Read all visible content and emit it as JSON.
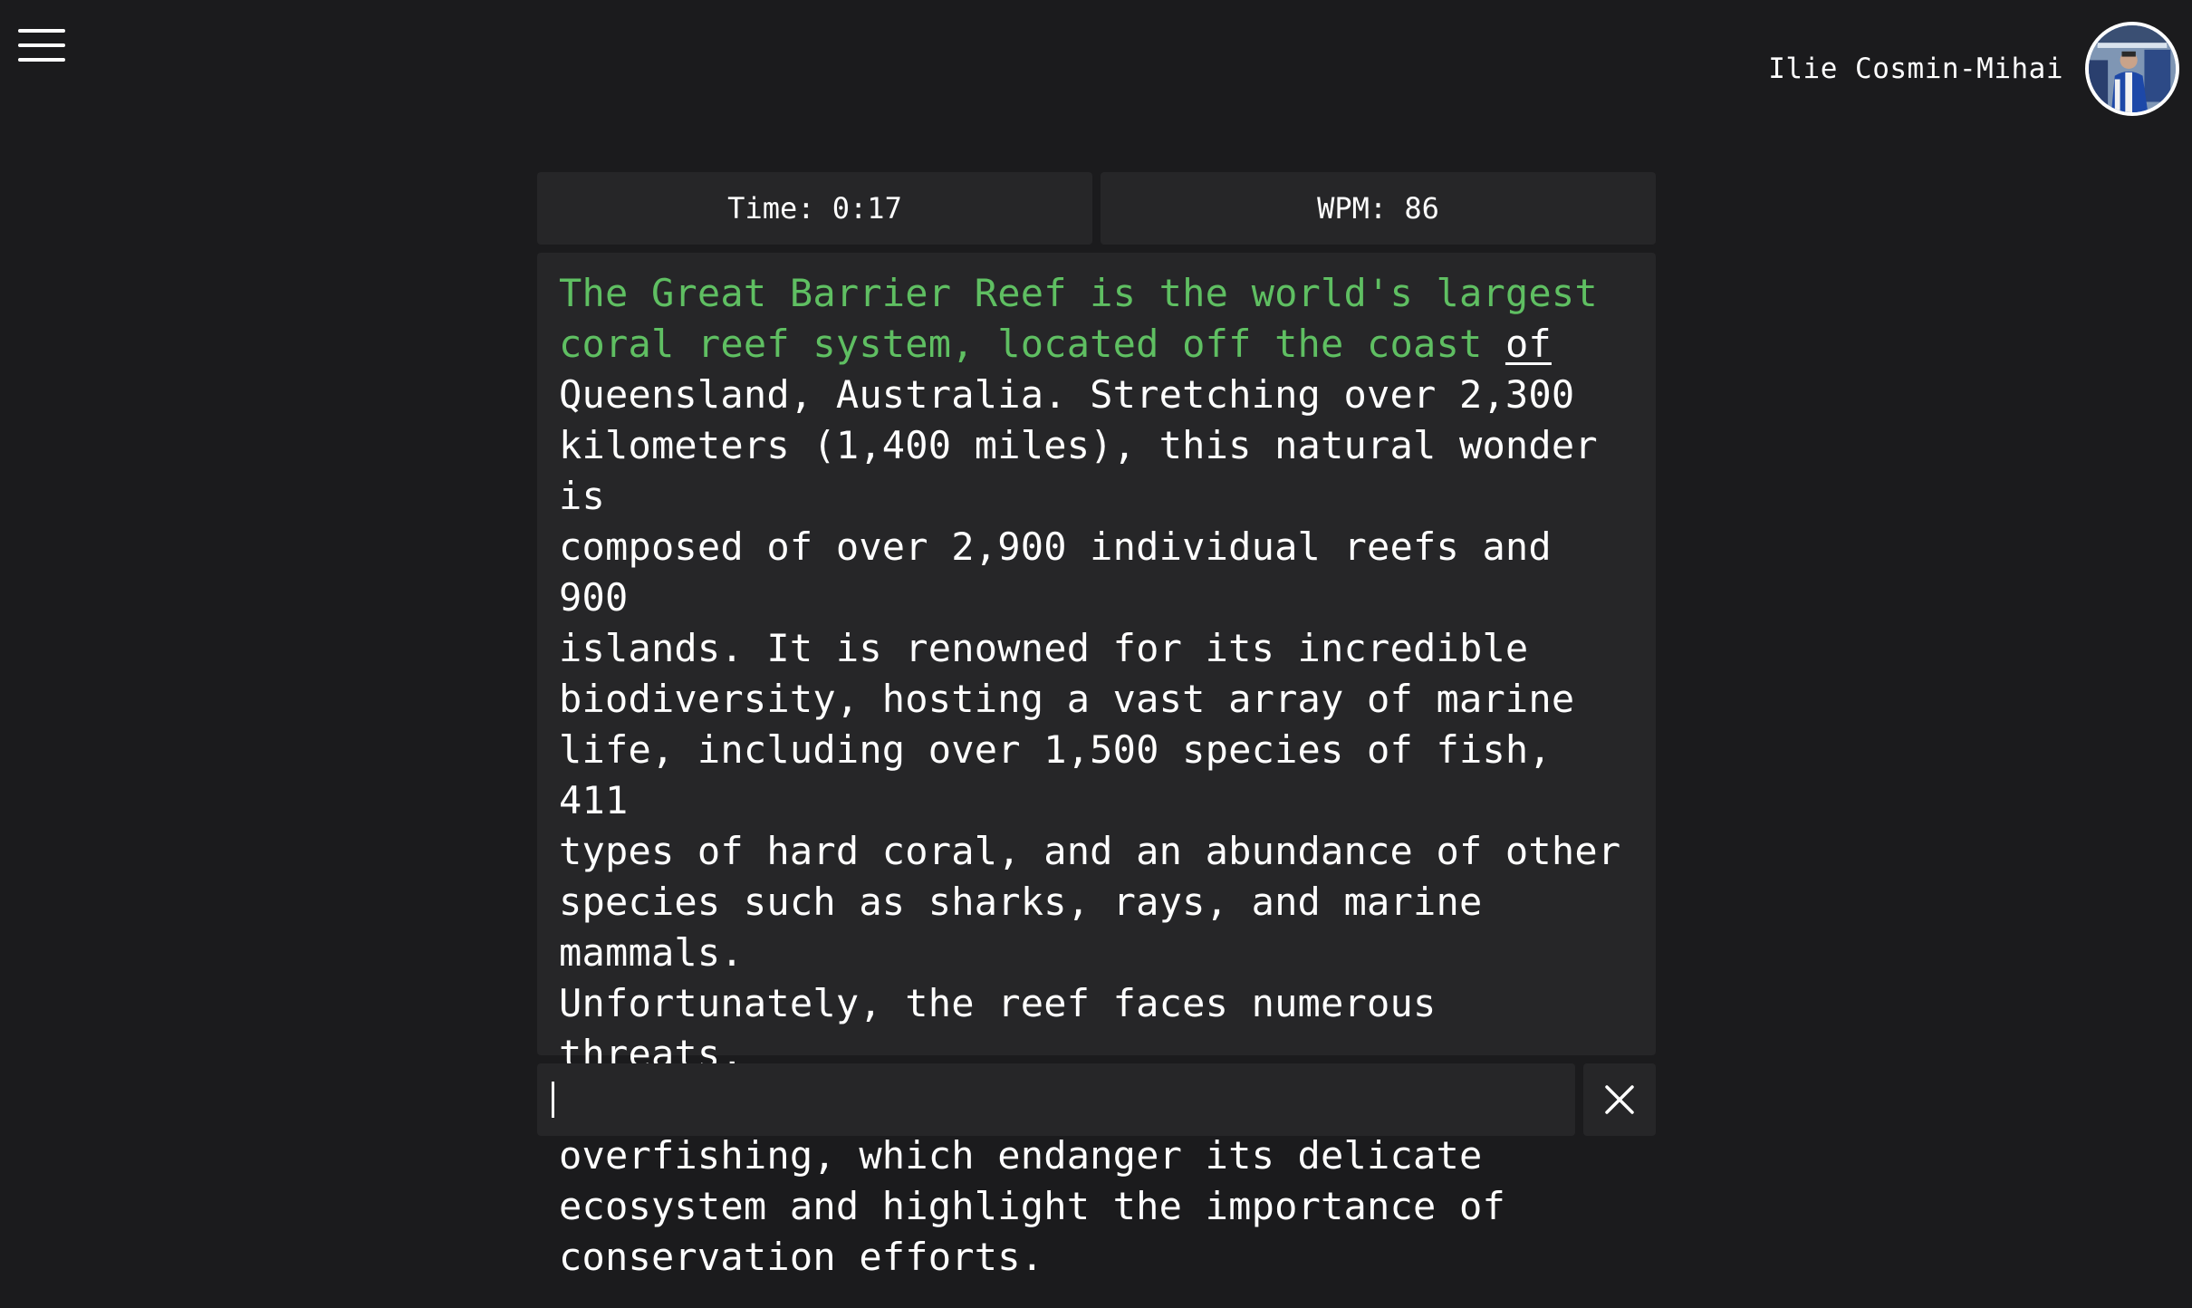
{
  "header": {
    "menu_icon": "hamburger-menu-icon",
    "user_name": "Ilie Cosmin-Mihai",
    "avatar_icon": "user-avatar"
  },
  "stats": {
    "time_label": "Time: 0:17",
    "wpm_label": "WPM: 86"
  },
  "passage": {
    "typed": "The Great Barrier Reef is the world's largest\ncoral reef system, located off the coast ",
    "current": "of",
    "remaining": "\nQueensland, Australia. Stretching over 2,300\nkilometers (1,400 miles), this natural wonder is\ncomposed of over 2,900 individual reefs and 900\nislands. It is renowned for its incredible\nbiodiversity, hosting a vast array of marine\nlife, including over 1,500 species of fish, 411\ntypes of hard coral, and an abundance of other\nspecies such as sharks, rays, and marine mammals.\nUnfortunately, the reef faces numerous threats,\nsuch as climate change, pollution, and\noverfishing, which endanger its delicate\necosystem and highlight the importance of\nconservation efforts."
  },
  "colors": {
    "background": "#1b1b1d",
    "panel": "#262628",
    "typed_text": "#5fbf62",
    "text": "#ffffff"
  },
  "input": {
    "value": "",
    "clear_icon": "close-icon"
  }
}
